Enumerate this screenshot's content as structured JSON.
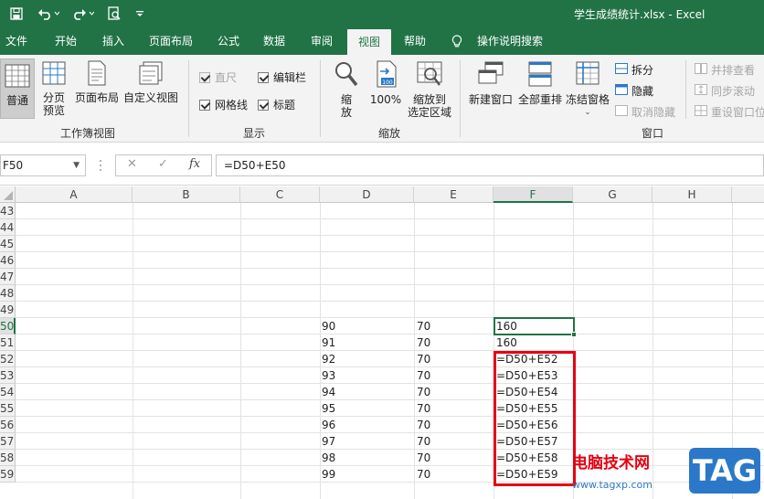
{
  "window": {
    "title": "学生成绩统计.xlsx  -  Excel"
  },
  "icons": {
    "save": "save-icon",
    "undo": "undo-icon",
    "redo": "redo-icon",
    "print_preview": "print-preview-icon",
    "customize": "customize-quick-access-icon"
  },
  "tabs": [
    {
      "label": "文件"
    },
    {
      "label": "开始"
    },
    {
      "label": "插入"
    },
    {
      "label": "页面布局"
    },
    {
      "label": "公式"
    },
    {
      "label": "数据"
    },
    {
      "label": "审阅"
    },
    {
      "label": "视图"
    },
    {
      "label": "帮助"
    },
    {
      "label": "操作说明搜索"
    }
  ],
  "active_tab": "视图",
  "ribbon": {
    "workbook_views": {
      "label": "工作簿视图",
      "normal": "普通",
      "page_break_1": "分页",
      "page_break_2": "预览",
      "page_layout": "页面布局",
      "custom_views": "自定义视图"
    },
    "show": {
      "label": "显示",
      "ruler": "直尺",
      "formula_bar": "编辑栏",
      "gridlines": "网格线",
      "headings": "标题"
    },
    "zoom": {
      "label": "缩放",
      "zoom_1": "缩",
      "zoom_2": "放",
      "hundred": "100%",
      "to_selection_1": "缩放到",
      "to_selection_2": "选定区域"
    },
    "window": {
      "label": "窗口",
      "new_window": "新建窗口",
      "arrange_all": "全部重排",
      "freeze_panes": "冻结窗格",
      "split": "拆分",
      "hide": "隐藏",
      "unhide": "取消隐藏",
      "side_by_side": "并排查看",
      "sync_scroll": "同步滚动",
      "reset_position": "重设窗口位"
    }
  },
  "formula_bar": {
    "name_box": "F50",
    "cancel": "✕",
    "enter": "✓",
    "fx": "fx",
    "formula": "=D50+E50"
  },
  "columns": [
    "A",
    "B",
    "C",
    "D",
    "E",
    "F",
    "G",
    "H"
  ],
  "selected_column": "F",
  "rows": [
    {
      "num": "43",
      "d": "",
      "e": "",
      "f": ""
    },
    {
      "num": "44",
      "d": "",
      "e": "",
      "f": ""
    },
    {
      "num": "45",
      "d": "",
      "e": "",
      "f": ""
    },
    {
      "num": "46",
      "d": "",
      "e": "",
      "f": ""
    },
    {
      "num": "47",
      "d": "",
      "e": "",
      "f": ""
    },
    {
      "num": "48",
      "d": "",
      "e": "",
      "f": ""
    },
    {
      "num": "49",
      "d": "",
      "e": "",
      "f": ""
    },
    {
      "num": "50",
      "d": "90",
      "e": "70",
      "f": "160"
    },
    {
      "num": "51",
      "d": "91",
      "e": "70",
      "f": "160"
    },
    {
      "num": "52",
      "d": "92",
      "e": "70",
      "f": "=D50+E52"
    },
    {
      "num": "53",
      "d": "93",
      "e": "70",
      "f": "=D50+E53"
    },
    {
      "num": "54",
      "d": "94",
      "e": "70",
      "f": "=D50+E54"
    },
    {
      "num": "55",
      "d": "95",
      "e": "70",
      "f": "=D50+E55"
    },
    {
      "num": "56",
      "d": "96",
      "e": "70",
      "f": "=D50+E56"
    },
    {
      "num": "57",
      "d": "97",
      "e": "70",
      "f": "=D50+E57"
    },
    {
      "num": "58",
      "d": "98",
      "e": "70",
      "f": "=D50+E58"
    },
    {
      "num": "59",
      "d": "99",
      "e": "70",
      "f": "=D50+E59"
    }
  ],
  "selected_row": "50",
  "colors": {
    "excel_green": "#217346",
    "highlight_red": "#e60012"
  },
  "watermark": {
    "cn": "电脑技术网",
    "url": "www.tagxp.com",
    "tag": "TAG"
  }
}
